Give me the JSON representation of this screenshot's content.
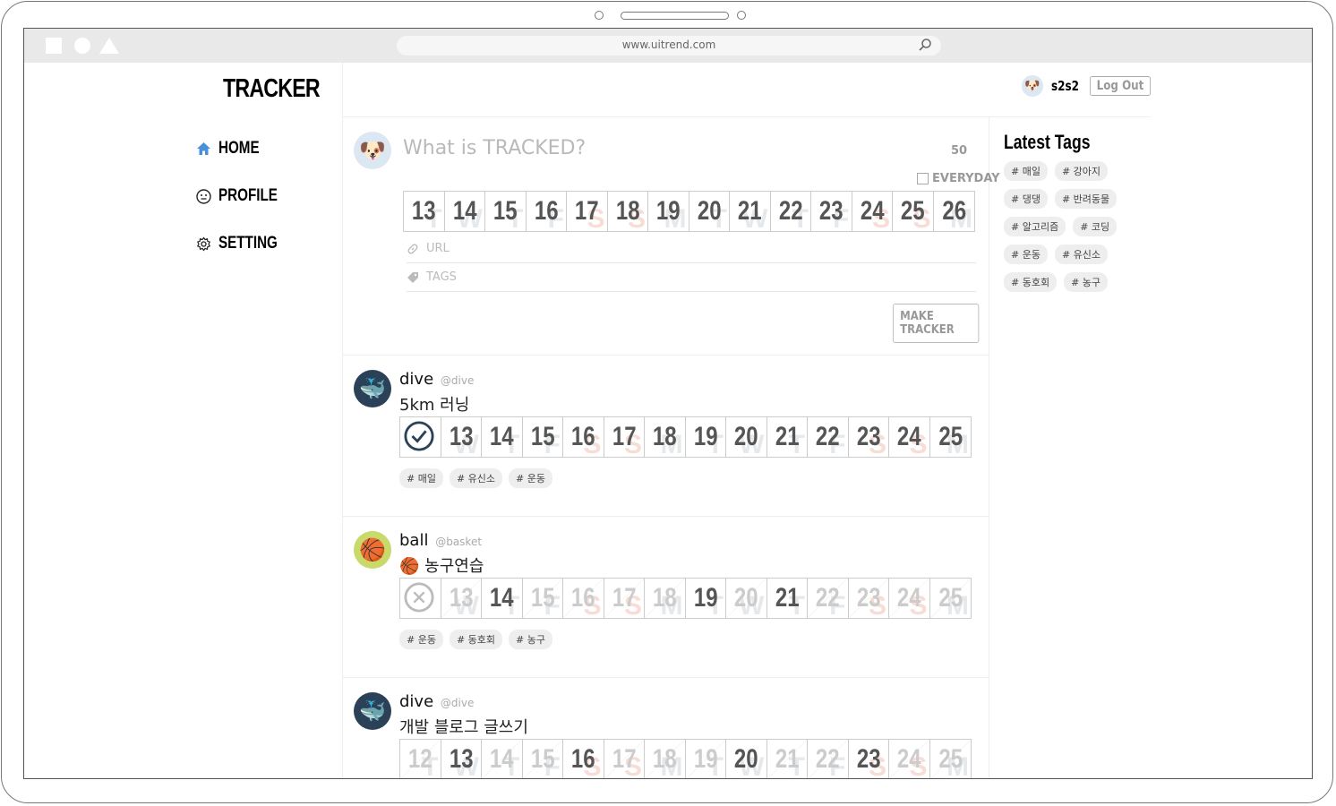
{
  "browser": {
    "url": "www.uitrend.com"
  },
  "nav": {
    "logo": "TRACKER",
    "items": [
      {
        "label": "HOME",
        "icon": "home-icon",
        "color": "#4a90d9"
      },
      {
        "label": "PROFILE",
        "icon": "smiley-icon"
      },
      {
        "label": "SETTING",
        "icon": "gear-icon"
      }
    ]
  },
  "user": {
    "name": "s2s2",
    "avatar": "🐶",
    "logout_label": "Log Out"
  },
  "composer": {
    "avatar": "🐶",
    "placeholder": "What is TRACKED?",
    "char_count": "50",
    "everyday_label": "EVERYDAY",
    "everyday_checked": false,
    "days": [
      "13",
      "14",
      "15",
      "16",
      "17",
      "18",
      "19",
      "20",
      "21",
      "22",
      "23",
      "24",
      "25",
      "26"
    ],
    "weekdays": [
      "T",
      "W",
      "T",
      "F",
      "S",
      "S",
      "M",
      "T",
      "W",
      "T",
      "F",
      "S",
      "S",
      "M"
    ],
    "url_placeholder": "URL",
    "tags_placeholder": "TAGS",
    "submit_label": "MAKE TRACKER"
  },
  "posts": [
    {
      "name": "dive",
      "handle": "@dive",
      "avatar": "🐳",
      "avatar_bg": "#2a4157",
      "title": "5km 러닝",
      "lead": "check",
      "days": [
        "13",
        "14",
        "15",
        "16",
        "17",
        "18",
        "19",
        "20",
        "21",
        "22",
        "23",
        "24",
        "25"
      ],
      "weekdays": [
        "W",
        "T",
        "F",
        "S",
        "S",
        "M",
        "T",
        "W",
        "T",
        "F",
        "S",
        "S",
        "M"
      ],
      "done": [
        true,
        true,
        true,
        true,
        true,
        true,
        true,
        true,
        true,
        true,
        true,
        true,
        true
      ],
      "tags": [
        "# 매일",
        "# 유신소",
        "# 운동"
      ]
    },
    {
      "name": "ball",
      "handle": "@basket",
      "avatar": "🏀",
      "avatar_bg": "#c9d96a",
      "title": "🏀 농구연습",
      "lead": "cross",
      "days": [
        "13",
        "14",
        "15",
        "16",
        "17",
        "18",
        "19",
        "20",
        "21",
        "22",
        "23",
        "24",
        "25"
      ],
      "weekdays": [
        "W",
        "T",
        "F",
        "S",
        "S",
        "M",
        "T",
        "W",
        "T",
        "F",
        "S",
        "S",
        "M"
      ],
      "done": [
        false,
        true,
        false,
        false,
        false,
        false,
        true,
        false,
        true,
        false,
        false,
        false,
        false
      ],
      "tags": [
        "# 운동",
        "# 동호회",
        "# 농구"
      ]
    },
    {
      "name": "dive",
      "handle": "@dive",
      "avatar": "🐳",
      "avatar_bg": "#2a4157",
      "title": "개발 블로그 글쓰기",
      "lead": "",
      "days": [
        "12",
        "13",
        "14",
        "15",
        "16",
        "17",
        "18",
        "19",
        "20",
        "21",
        "22",
        "23",
        "24",
        "25"
      ],
      "weekdays": [
        "T",
        "W",
        "T",
        "F",
        "S",
        "S",
        "M",
        "T",
        "W",
        "T",
        "F",
        "S",
        "S",
        "M"
      ],
      "done": [
        false,
        true,
        false,
        false,
        true,
        false,
        false,
        false,
        true,
        false,
        false,
        true,
        false,
        false
      ],
      "tags": []
    }
  ],
  "sidebar": {
    "title": "Latest Tags",
    "tags": [
      "# 매일",
      "# 강아지",
      "# 댕댕",
      "# 반려동물",
      "# 알고리즘",
      "# 코딩",
      "# 운동",
      "# 유신소",
      "# 동호회",
      "# 농구"
    ]
  }
}
